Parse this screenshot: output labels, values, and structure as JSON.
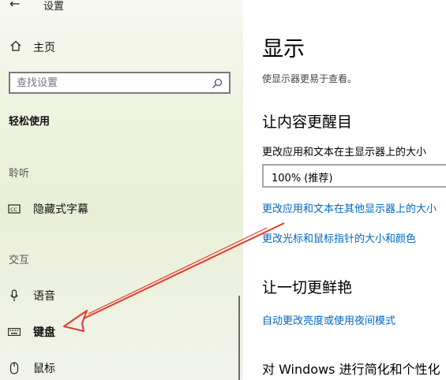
{
  "window": {
    "title": "设置",
    "back_icon": "←"
  },
  "sidebar": {
    "home_label": "主页",
    "search_placeholder": "查找设置",
    "section_title": "轻松使用",
    "group_hearing": "聆听",
    "caption_label": "隐藏式字幕",
    "group_interaction": "交互",
    "speech_label": "语音",
    "keyboard_label": "键盘",
    "mouse_label": "鼠标"
  },
  "main": {
    "title": "显示",
    "subtitle": "使显示器更易于查看。",
    "section_bigger": "让内容更醒目",
    "size_label": "更改应用和文本在主显示器上的大小",
    "size_value": "100% (推荐)",
    "link_other_displays": "更改应用和文本在其他显示器上的大小",
    "link_pointer": "更改光标和鼠标指针的大小和颜色",
    "section_brighter": "让一切更鲜艳",
    "link_brightness": "自动更改亮度或使用夜间模式",
    "section_windows": "对 Windows 进行简化和个性化"
  },
  "annotation": {
    "arrow_color": "#e23a2e"
  },
  "colors": {
    "link": "#0067c0",
    "sidebar_bg": "#eef3df"
  }
}
